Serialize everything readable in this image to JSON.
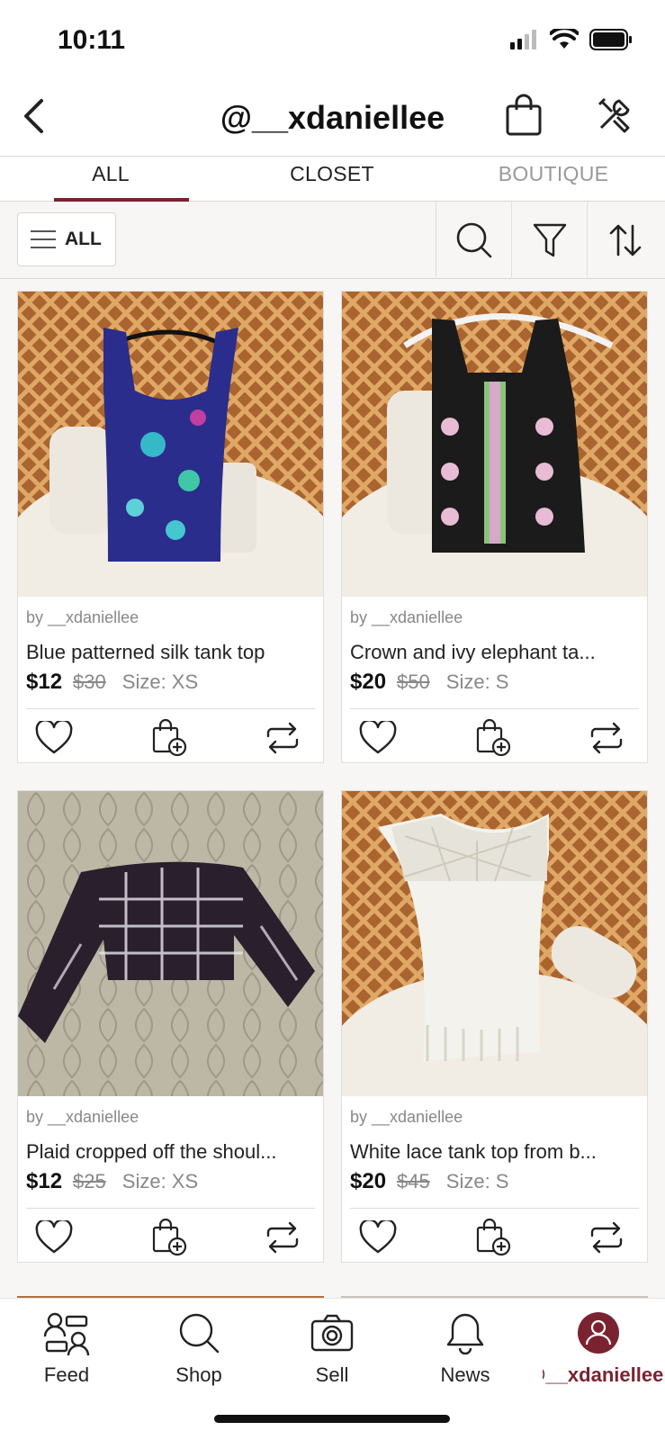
{
  "status": {
    "time": "10:11"
  },
  "header": {
    "title": "@__xdaniellee"
  },
  "tabs": [
    {
      "label": "ALL"
    },
    {
      "label": "CLOSET"
    },
    {
      "label": "BOUTIQUE"
    }
  ],
  "filter": {
    "all_label": "ALL"
  },
  "listings": [
    {
      "by": "by __xdaniellee",
      "title": "Blue patterned silk tank top",
      "price": "$12",
      "original_price": "$30",
      "size": "Size: XS"
    },
    {
      "by": "by __xdaniellee",
      "title": "Crown and ivy elephant ta...",
      "price": "$20",
      "original_price": "$50",
      "size": "Size: S"
    },
    {
      "by": "by __xdaniellee",
      "title": "Plaid cropped off the shoul...",
      "price": "$12",
      "original_price": "$25",
      "size": "Size: XS"
    },
    {
      "by": "by __xdaniellee",
      "title": "White lace tank top from b...",
      "price": "$20",
      "original_price": "$45",
      "size": "Size: S"
    }
  ],
  "nav": [
    {
      "label": "Feed"
    },
    {
      "label": "Shop"
    },
    {
      "label": "Sell"
    },
    {
      "label": "News"
    },
    {
      "label": "@__xdaniellee"
    }
  ],
  "colors": {
    "accent": "#7b2230",
    "background": "#f7f6f4"
  }
}
